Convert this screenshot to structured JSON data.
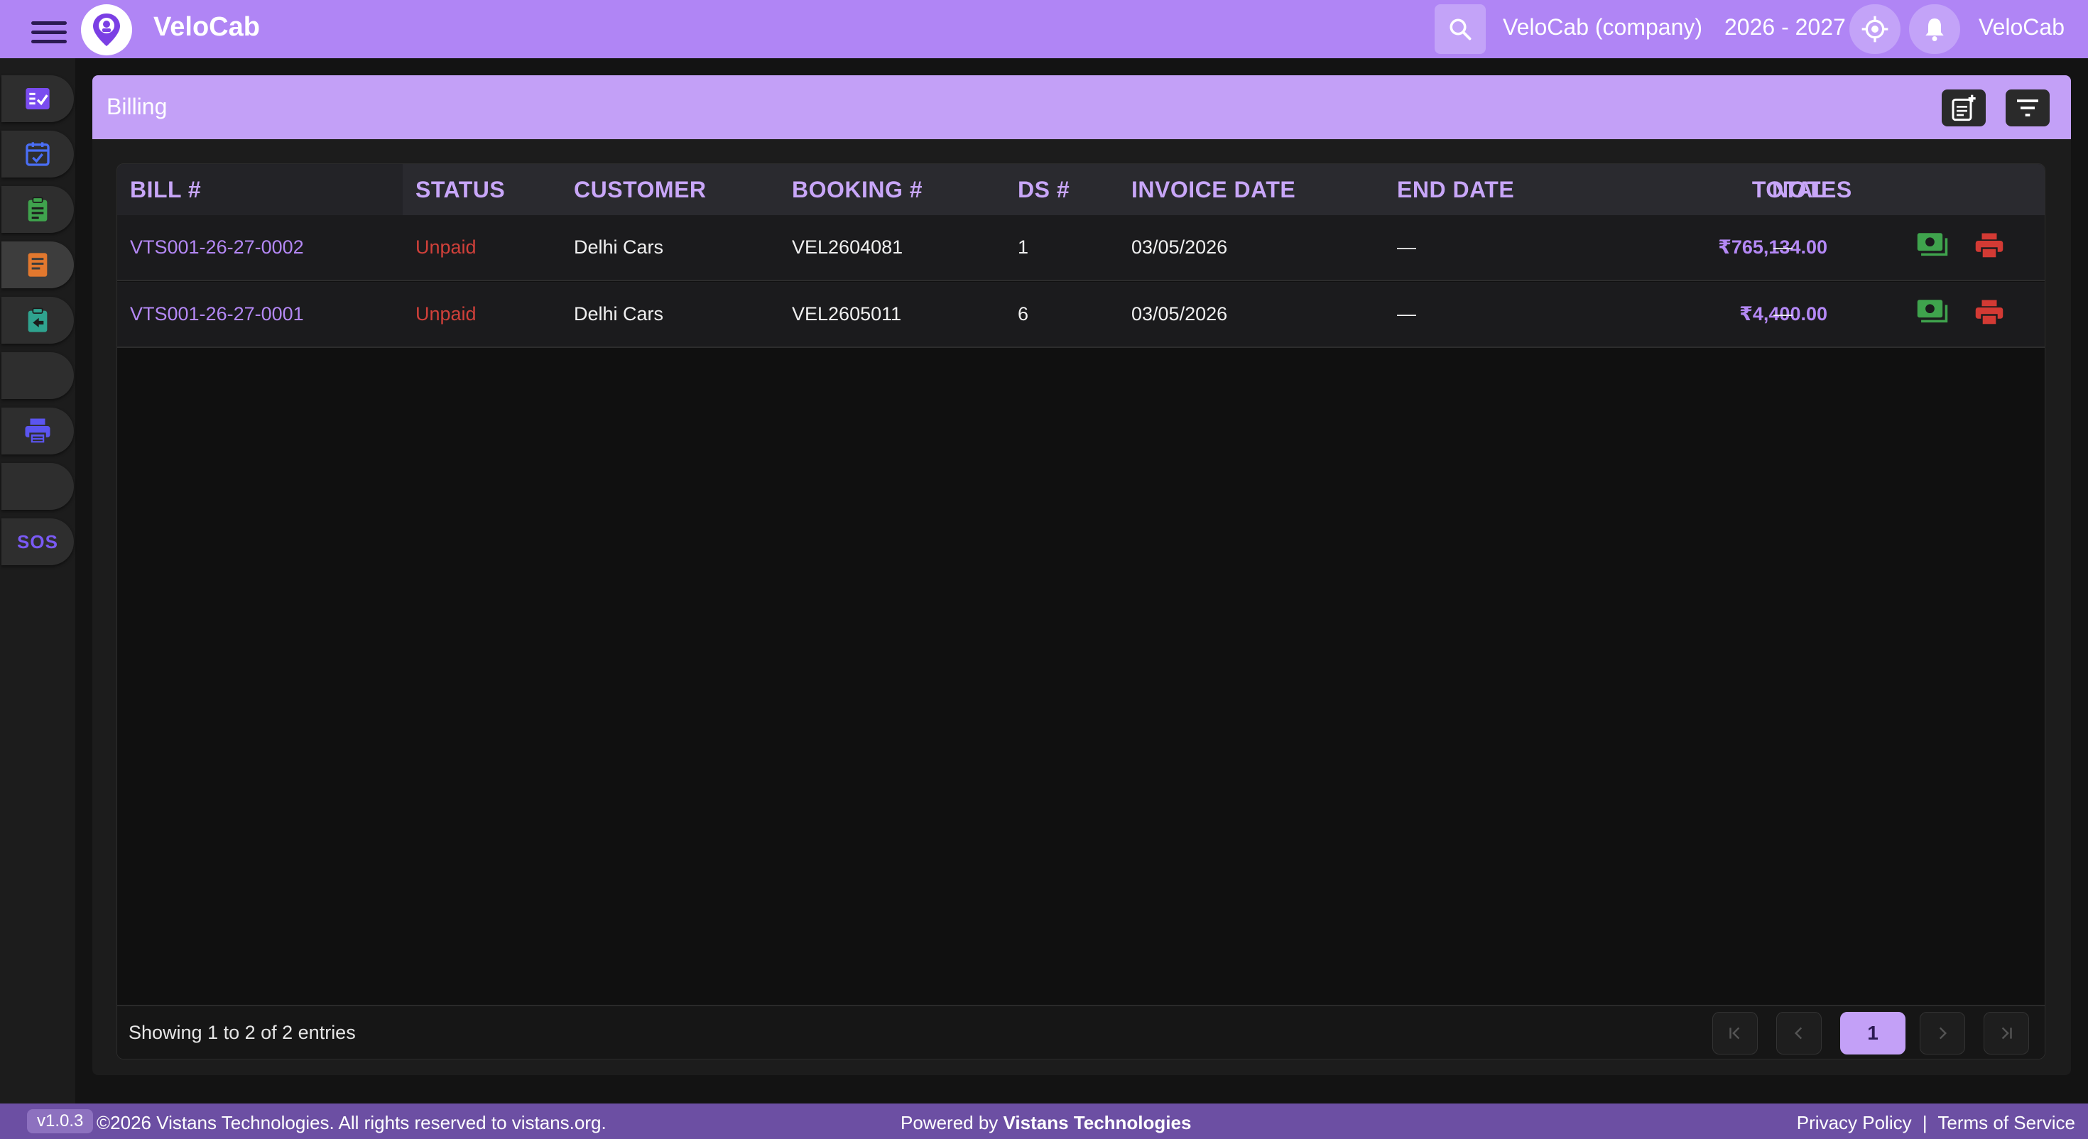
{
  "app": {
    "brand": "VeloCab",
    "company": "VeloCab (company)",
    "fiscal_year": "2026 - 2027",
    "user_name": "VeloCab"
  },
  "sidebar": {
    "items": [
      {
        "name": "tasks",
        "icon": "checklist-icon"
      },
      {
        "name": "calendar",
        "icon": "calendar-check-icon"
      },
      {
        "name": "clipboard",
        "icon": "clipboard-icon"
      },
      {
        "name": "billing",
        "icon": "receipt-icon",
        "active": true
      },
      {
        "name": "returns",
        "icon": "clipboard-back-icon"
      },
      {
        "name": "blank-1",
        "icon": ""
      },
      {
        "name": "print",
        "icon": "printer-icon"
      },
      {
        "name": "blank-2",
        "icon": ""
      },
      {
        "name": "sos",
        "label": "SOS"
      }
    ]
  },
  "page": {
    "title": "Billing"
  },
  "table": {
    "columns": {
      "bill": "BILL #",
      "status": "STATUS",
      "customer": "CUSTOMER",
      "booking": "BOOKING #",
      "ds": "DS #",
      "invoice_date": "INVOICE DATE",
      "end_date": "END DATE",
      "total": "TOTAL",
      "notes": "NOTES"
    },
    "rows": [
      {
        "bill": "VTS001-26-27-0002",
        "status": "Unpaid",
        "customer": "Delhi Cars",
        "booking": "VEL2604081",
        "ds": "1",
        "invoice_date": "03/05/2026",
        "end_date": "—",
        "total": "₹765,134.00",
        "notes": "—"
      },
      {
        "bill": "VTS001-26-27-0001",
        "status": "Unpaid",
        "customer": "Delhi Cars",
        "booking": "VEL2605011",
        "ds": "6",
        "invoice_date": "03/05/2026",
        "end_date": "—",
        "total": "₹4,400.00",
        "notes": "—"
      }
    ],
    "showing": "Showing 1 to 2 of 2 entries",
    "current_page": "1"
  },
  "footer": {
    "version": "v1.0.3",
    "copyright": "©2026 Vistans Technologies. All rights reserved to vistans.org.",
    "powered_prefix": "Powered by",
    "powered_by": "Vistans Technologies",
    "privacy": "Privacy Policy",
    "separator": "|",
    "terms": "Terms of Service"
  },
  "colors": {
    "accent": "#b085f5",
    "unpaid": "#d0403a",
    "money_icon": "#3fa34d",
    "print_icon": "#d33a34"
  }
}
